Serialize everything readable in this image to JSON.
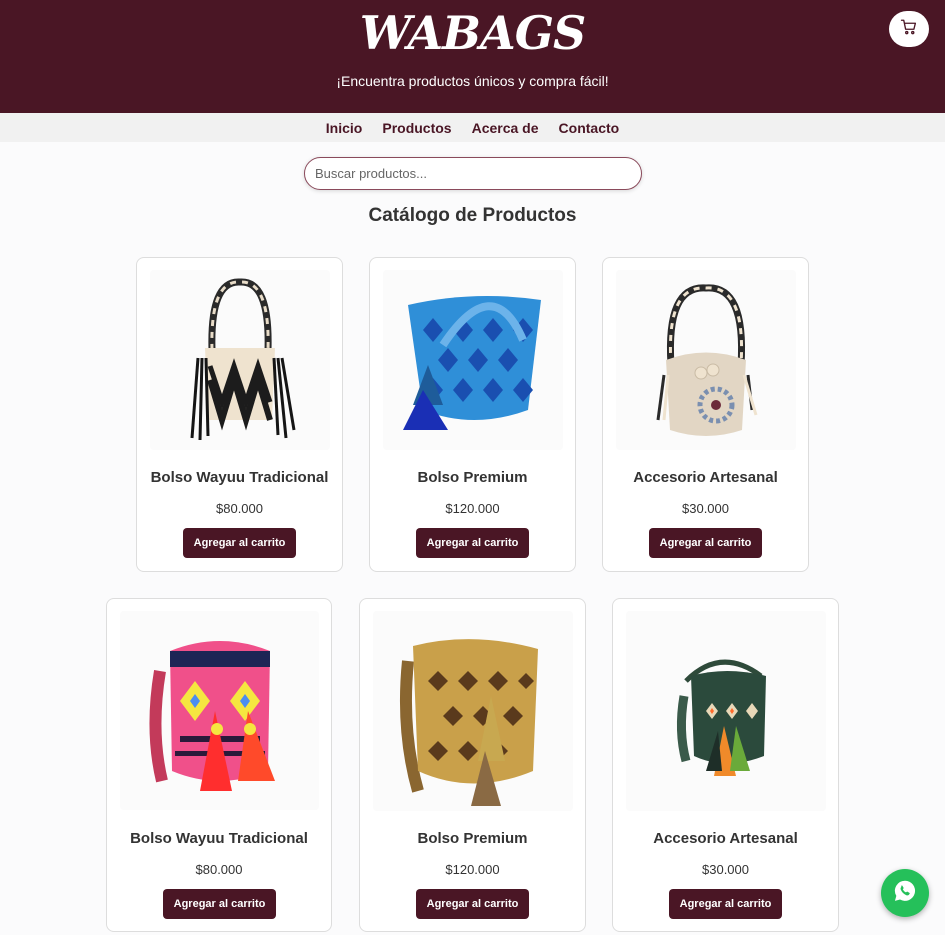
{
  "header": {
    "logo": "WABAGS",
    "tagline": "¡Encuentra productos únicos y compra fácil!"
  },
  "nav": {
    "items": [
      "Inicio",
      "Productos",
      "Acerca de",
      "Contacto"
    ]
  },
  "search": {
    "placeholder": "Buscar productos..."
  },
  "catalog": {
    "title": "Catálogo de Productos",
    "products": [
      {
        "name": "Bolso Wayuu Tradicional",
        "price": "$80.000",
        "button": "Agregar al carrito",
        "image": "bag-black-white"
      },
      {
        "name": "Bolso Premium",
        "price": "$120.000",
        "button": "Agregar al carrito",
        "image": "bag-blue"
      },
      {
        "name": "Accesorio Artesanal",
        "price": "$30.000",
        "button": "Agregar al carrito",
        "image": "bag-beige-flower"
      },
      {
        "name": "Bolso Wayuu Tradicional",
        "price": "$80.000",
        "button": "Agregar al carrito",
        "image": "bag-colorful-pink"
      },
      {
        "name": "Bolso Premium",
        "price": "$120.000",
        "button": "Agregar al carrito",
        "image": "bag-mustard-brown"
      },
      {
        "name": "Accesorio Artesanal",
        "price": "$30.000",
        "button": "Agregar al carrito",
        "image": "bag-dark-green"
      }
    ]
  },
  "icons": {
    "cart": "cart-icon",
    "whatsapp": "whatsapp-icon"
  },
  "colors": {
    "brand": "#4a1625",
    "whatsapp": "#25c05a"
  }
}
